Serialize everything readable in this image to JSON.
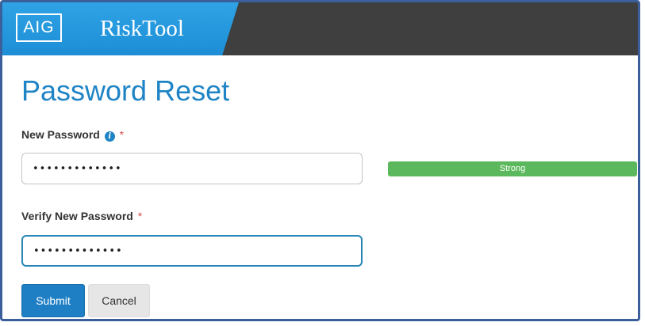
{
  "header": {
    "logo_text": "AIG",
    "app_name": "RiskTool",
    "brand_color": "#1d8ed6",
    "bar_color": "#3f3f3f"
  },
  "page": {
    "title": "Password Reset"
  },
  "form": {
    "new_password": {
      "label": "New Password",
      "info_icon": "info-circle-icon",
      "required_mark": "*",
      "value": "•••••••••••••"
    },
    "strength": {
      "label": "Strong",
      "color": "#5cb85c"
    },
    "verify_password": {
      "label": "Verify New Password",
      "required_mark": "*",
      "value": "•••••••••••••"
    },
    "submit_label": "Submit",
    "cancel_label": "Cancel"
  }
}
